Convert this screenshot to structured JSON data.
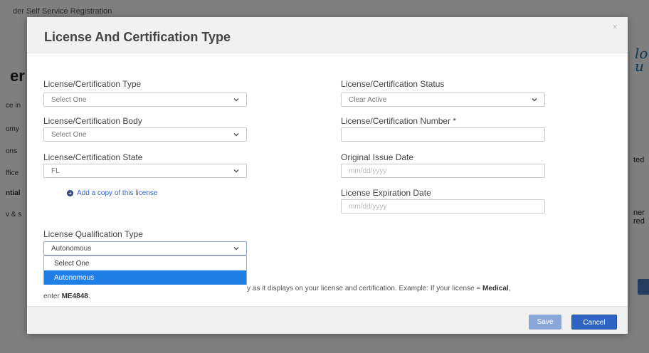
{
  "background": {
    "breadcrumb": "der Self Service Registration",
    "heading": "er",
    "logo": "lo\nu",
    "side_items": [
      "ce in",
      "omy",
      "ons",
      "ffice",
      "ntial",
      "v & s"
    ],
    "right_fragments": [
      "ted",
      "ner",
      "red"
    ]
  },
  "modal": {
    "title": "License And Certification Type",
    "close": "×",
    "left": {
      "type_label": "License/Certification Type",
      "type_value": "Select One",
      "body_label": "License/Certification Body",
      "body_value": "Select One",
      "state_label": "License/Certification State",
      "state_value": "FL",
      "add_copy": "Add a copy of this license",
      "qual_label": "License Qualification Type",
      "qual_value": "Autonomous",
      "qual_options": [
        "Select One",
        "Autonomous"
      ]
    },
    "right": {
      "status_label": "License/Certification Status",
      "status_value": "Clear Active",
      "number_label": "License/Certification Number *",
      "number_value": "",
      "issue_label": "Original Issue Date",
      "issue_placeholder": "mm/dd/yyyy",
      "expiration_label": "License Expiration Date",
      "expiration_placeholder": "mm/dd/yyyy"
    },
    "note": {
      "part1": "y as it displays on your license and certification. Example: If your license = ",
      "bold1": "Medical",
      "part2": ",",
      "part3": "enter ",
      "bold2": "ME4848",
      "part4": "."
    },
    "footer": {
      "save_label": "Save",
      "cancel_label": "Cancel"
    }
  },
  "colors": {
    "accent": "#2f64c4",
    "selected_option": "#1f7fe6",
    "save_disabled": "#8aa7d9"
  }
}
